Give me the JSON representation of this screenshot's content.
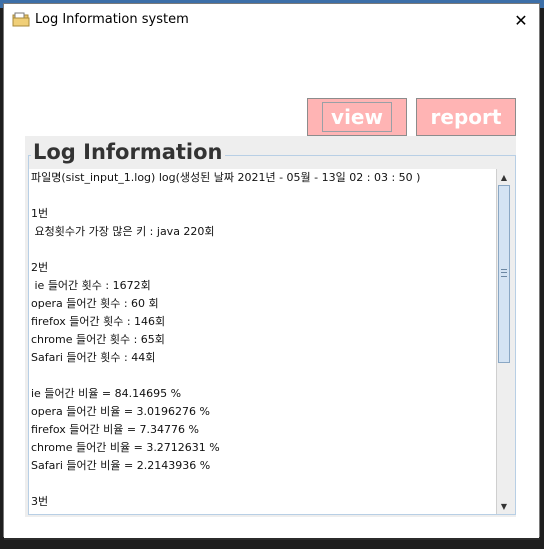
{
  "window": {
    "title": "Log Information system",
    "close_glyph": "✕"
  },
  "buttons": {
    "view_label": "view",
    "report_label": "report"
  },
  "panel": {
    "title": "Log Information"
  },
  "log_lines": [
    "파일명(sist_input_1.log) log(생성된 날짜 2021년 - 05월 - 13일 02 : 03 : 50 )",
    "",
    "1번",
    " 요청횟수가 가장 많은 키 : java 220회",
    "",
    "2번",
    " ie 들어간 횟수 : 1672회",
    "opera 들어간 횟수 : 60 회",
    "firefox 들어간 횟수 : 146회",
    "chrome 들어간 횟수 : 65회",
    "Safari 들어간 횟수 : 44회",
    "",
    "ie 들어간 비율 = 84.14695 %",
    "opera 들어간 비율 = 3.0196276 %",
    "firefox 들어간 비율 = 7.34776 %",
    "chrome 들어간 비율 = 3.2712631 %",
    "Safari 들어간 비율 = 2.2143936 %",
    "",
    "3번"
  ],
  "icons": {
    "app": "folder-icon",
    "close": "close-icon",
    "scroll_up": "arrow-up-icon",
    "scroll_down": "arrow-down-icon"
  },
  "colors": {
    "button_bg": "#ffb4b4",
    "button_text": "#ffffff",
    "panel_bg": "#eeeeee",
    "scroll_thumb": "#d4e3f3"
  }
}
